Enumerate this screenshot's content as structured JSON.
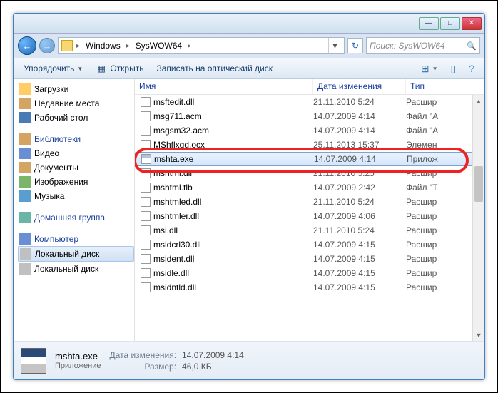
{
  "titlebar": {
    "min": "—",
    "max": "□",
    "close": "✕"
  },
  "nav": {
    "back": "←",
    "fwd": "→",
    "refresh": "↻"
  },
  "breadcrumb": {
    "items": [
      "Windows",
      "SysWOW64"
    ],
    "dropdown": "▾"
  },
  "search": {
    "placeholder": "Поиск: SysWOW64",
    "icon": "🔍"
  },
  "toolbar": {
    "organize": "Упорядочить",
    "open": "Открыть",
    "burn": "Записать на оптический диск",
    "view_icon": "⊞",
    "help_icon": "?"
  },
  "navpane": {
    "downloads": "Загрузки",
    "recent": "Недавние места",
    "desktop": "Рабочий стол",
    "libraries": "Библиотеки",
    "video": "Видео",
    "documents": "Документы",
    "images": "Изображения",
    "music": "Музыка",
    "homegroup": "Домашняя группа",
    "computer": "Компьютер",
    "localdisk": "Локальный диск",
    "localdisk2": "Локальный диск"
  },
  "columns": {
    "name": "Имя",
    "date": "Дата изменения",
    "type": "Тип"
  },
  "files": [
    {
      "name": "msftedit.dll",
      "date": "21.11.2010 5:24",
      "type": "Расшир"
    },
    {
      "name": "msg711.acm",
      "date": "14.07.2009 4:14",
      "type": "Файл \"A"
    },
    {
      "name": "msgsm32.acm",
      "date": "14.07.2009 4:14",
      "type": "Файл \"A"
    },
    {
      "name": "MShflxgd.ocx",
      "date": "25.11.2013 15:37",
      "type": "Элемен"
    },
    {
      "name": "mshta.exe",
      "date": "14.07.2009 4:14",
      "type": "Прилож",
      "selected": true
    },
    {
      "name": "mshtml.dll",
      "date": "21.11.2010 5:25",
      "type": "Расшир"
    },
    {
      "name": "mshtml.tlb",
      "date": "14.07.2009 2:42",
      "type": "Файл \"T"
    },
    {
      "name": "mshtmled.dll",
      "date": "21.11.2010 5:24",
      "type": "Расшир"
    },
    {
      "name": "mshtmler.dll",
      "date": "14.07.2009 4:06",
      "type": "Расшир"
    },
    {
      "name": "msi.dll",
      "date": "21.11.2010 5:24",
      "type": "Расшир"
    },
    {
      "name": "msidcrl30.dll",
      "date": "14.07.2009 4:15",
      "type": "Расшир"
    },
    {
      "name": "msident.dll",
      "date": "14.07.2009 4:15",
      "type": "Расшир"
    },
    {
      "name": "msidle.dll",
      "date": "14.07.2009 4:15",
      "type": "Расшир"
    },
    {
      "name": "msidntld.dll",
      "date": "14.07.2009 4:15",
      "type": "Расшир"
    }
  ],
  "details": {
    "filename": "mshta.exe",
    "filetype": "Приложение",
    "date_lbl": "Дата изменения:",
    "date_val": "14.07.2009 4:14",
    "size_lbl": "Размер:",
    "size_val": "46,0 КБ"
  }
}
